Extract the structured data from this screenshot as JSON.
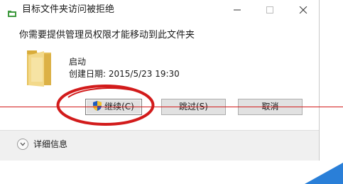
{
  "dialog": {
    "title": "目标文件夹访问被拒绝",
    "message": "你需要提供管理员权限才能移动到此文件夹",
    "item": {
      "name": "启动",
      "date_text": "创建日期: 2015/5/23 19:30"
    },
    "buttons": {
      "continue_label": "继续(C)",
      "skip_label": "跳过(S)",
      "cancel_label": "取消"
    },
    "details_label": "详细信息"
  },
  "icons": {
    "app": "folder-transfer-icon",
    "item": "folder-icon",
    "continue": "uac-shield-icon",
    "details": "chevron-down-icon"
  },
  "colors": {
    "annotation": "#d21b1b",
    "corner_accent": "#2a7fd8",
    "footer_bg": "#f0f0f0",
    "button_bg": "#e1e1e1"
  }
}
